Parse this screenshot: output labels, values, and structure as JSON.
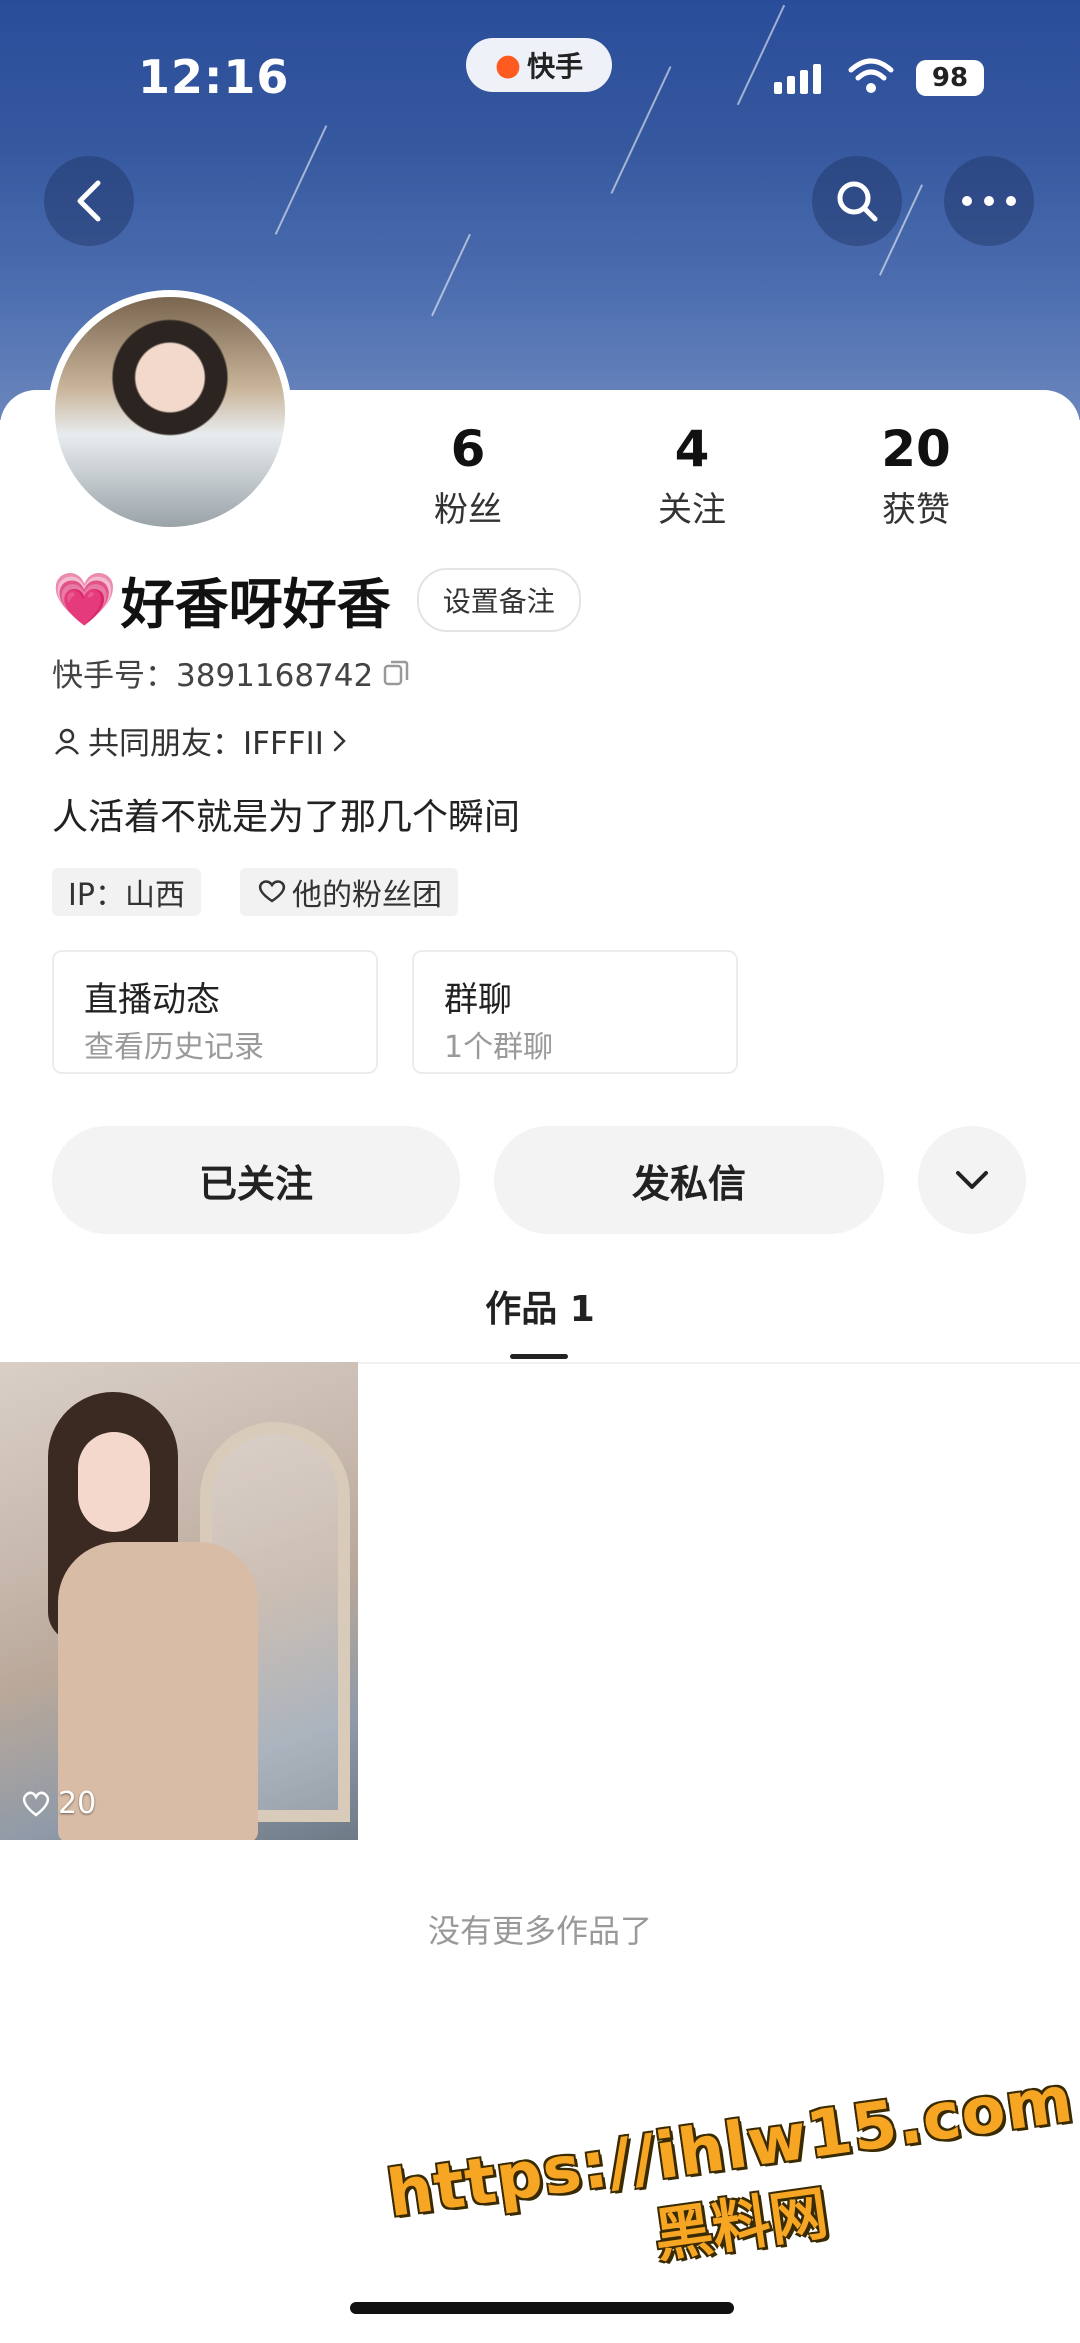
{
  "status_bar": {
    "time": "12:16",
    "app_badge": "快手",
    "battery": "98"
  },
  "header": {
    "back_icon": "chevron-left-icon",
    "search_icon": "search-icon",
    "more_icon": "more-icon"
  },
  "profile": {
    "stats": [
      {
        "value": "6",
        "label": "粉丝"
      },
      {
        "value": "4",
        "label": "关注"
      },
      {
        "value": "20",
        "label": "获赞"
      }
    ],
    "heart_emoji": "💗",
    "name": "好香呀好香",
    "remark_button": "设置备注",
    "kuaishou_id": "快手号：3891168742",
    "mutual_friends": "共同朋友：IFFFII",
    "bio": "人活着不就是为了那几个瞬间",
    "tags": {
      "ip": "IP：山西",
      "fan_group": "他的粉丝团"
    },
    "info_cards": [
      {
        "title": "直播动态",
        "subtitle": "查看历史记录"
      },
      {
        "title": "群聊",
        "subtitle": "1个群聊"
      }
    ],
    "actions": {
      "follow": "已关注",
      "message": "发私信"
    }
  },
  "tabs": {
    "works": "作品 1"
  },
  "works": [
    {
      "likes": "20"
    }
  ],
  "no_more": "没有更多作品了",
  "watermark": {
    "line1": "https://ihlw15.com",
    "line2": "黑料网"
  },
  "colors": {
    "header_blue": "#36589f",
    "heart_pink": "#ff3d8b",
    "watermark_orange": "#f6a623"
  }
}
